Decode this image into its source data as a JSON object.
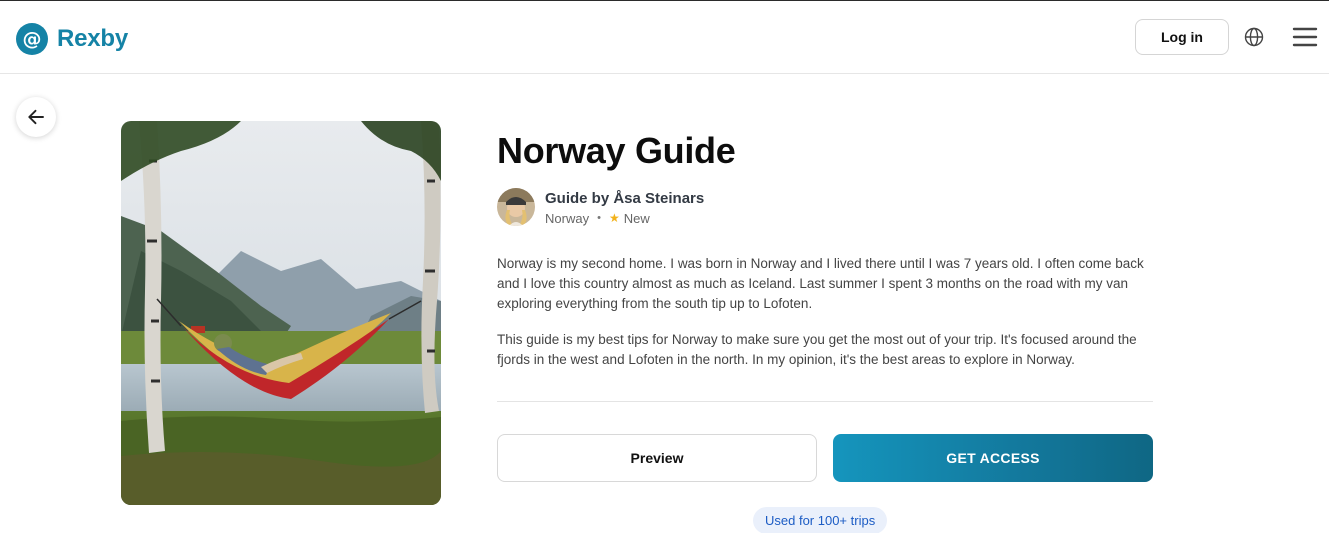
{
  "header": {
    "logo_mark": "@",
    "logo_text": "Rexby",
    "login_label": "Log in",
    "globe_icon": "globe-icon",
    "menu_icon": "hamburger-menu-icon"
  },
  "nav": {
    "back_icon": "arrow-left-icon"
  },
  "guide": {
    "title": "Norway Guide",
    "author_line": "Guide by Åsa Steinars",
    "location": "Norway",
    "separator": "•",
    "rating_icon": "★",
    "status": "New",
    "description": [
      "Norway is my second home. I was born in Norway and I lived there until I was 7 years old. I often come back and I love this country almost as much as Iceland. Last summer I spent 3 months on the road with my van exploring everything from the south tip up to Lofoten.",
      "This guide is my best tips for Norway to make sure you get the most out of your trip. It's focused around the fjords in the west and Lofoten in the north. In my opinion, it's the best areas to explore in Norway."
    ],
    "preview_label": "Preview",
    "access_label": "GET ACCESS",
    "usage_badge": "Used for 100+ trips"
  },
  "colors": {
    "brand": "#1583a6",
    "access_gradient_start": "#1595bd",
    "access_gradient_end": "#0f6784",
    "star": "#f2b21b",
    "badge_bg": "#eaf0fb",
    "badge_text": "#1c5cc4"
  }
}
